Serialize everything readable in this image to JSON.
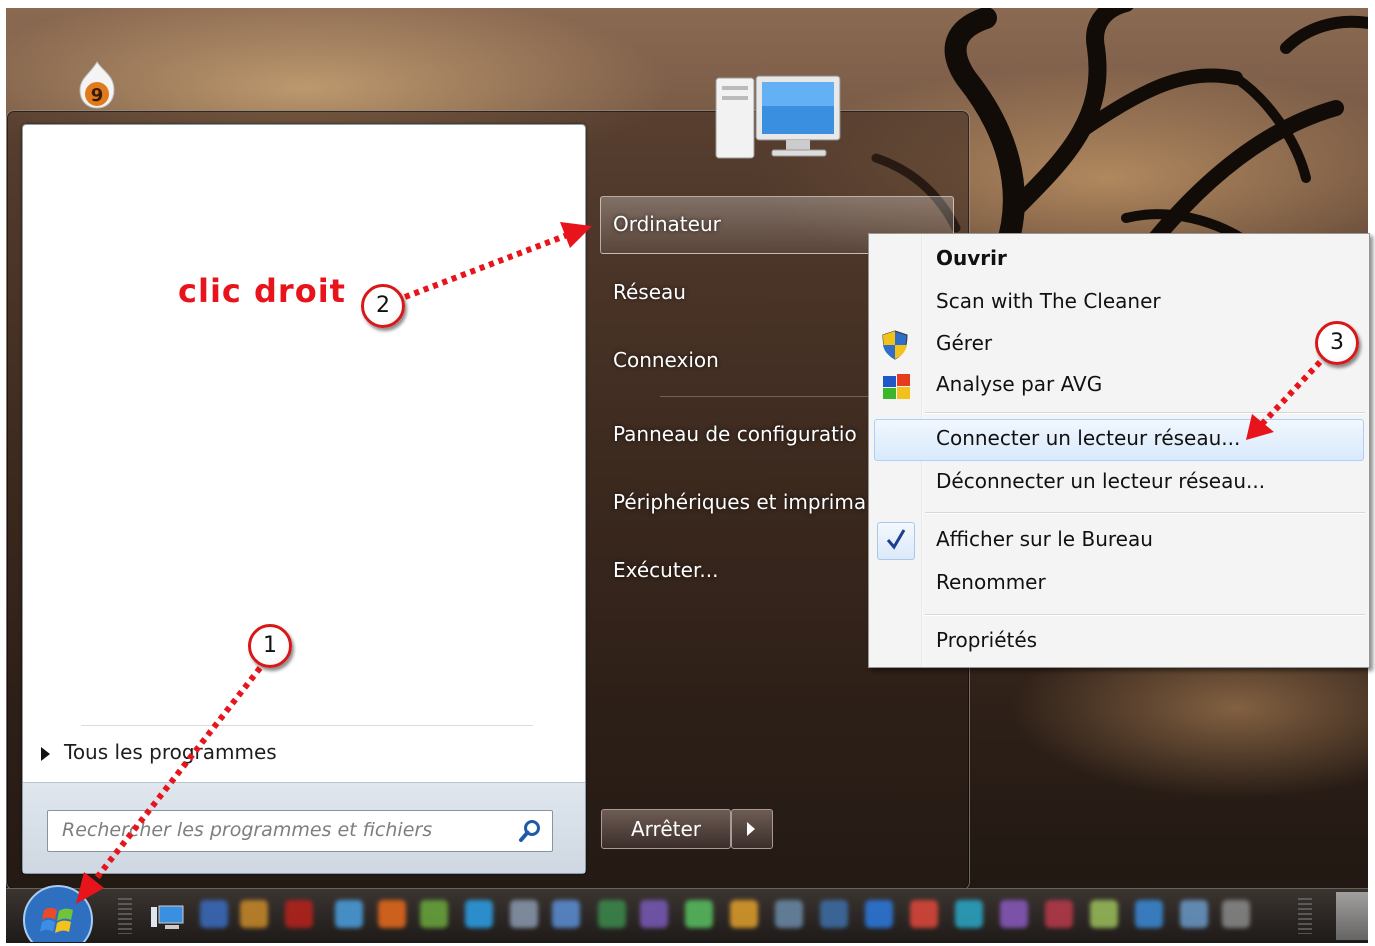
{
  "annotation": {
    "clic_droit": "clic droit",
    "marker_1": "1",
    "marker_2": "2",
    "marker_3": "3",
    "color": "#e8141b"
  },
  "desktop": {
    "badge_icon": "firefox-nine-badge-icon",
    "computer_icon": "computer-monitor-icon"
  },
  "start_menu": {
    "all_programs": "Tous les programmes",
    "search_placeholder": "Rechercher les programmes et fichiers",
    "right_items": [
      {
        "label": "Ordinateur"
      },
      {
        "label": "Réseau"
      },
      {
        "label": "Connexion"
      },
      {
        "label": "Panneau de configuratio"
      },
      {
        "label": "Périphériques et imprima"
      },
      {
        "label": "Exécuter..."
      }
    ],
    "shutdown_label": "Arrêter"
  },
  "context_menu": {
    "items": [
      {
        "label": "Ouvrir",
        "bold": true
      },
      {
        "label": "Scan with The Cleaner"
      },
      {
        "label": "Gérer",
        "icon": "uac-shield-icon"
      },
      {
        "label": "Analyse par AVG",
        "icon": "avg-icon"
      },
      {
        "label": "Connecter un lecteur réseau...",
        "highlighted": true
      },
      {
        "label": "Déconnecter un lecteur réseau..."
      },
      {
        "label": "Afficher sur le Bureau",
        "checked": true
      },
      {
        "label": "Renommer"
      },
      {
        "label": "Propriétés"
      }
    ],
    "highlight_color": "#d9e9fb"
  },
  "taskbar": {
    "start_button": "windows-start-orb-icon",
    "show_desktop_icon": "monitor-icon"
  }
}
